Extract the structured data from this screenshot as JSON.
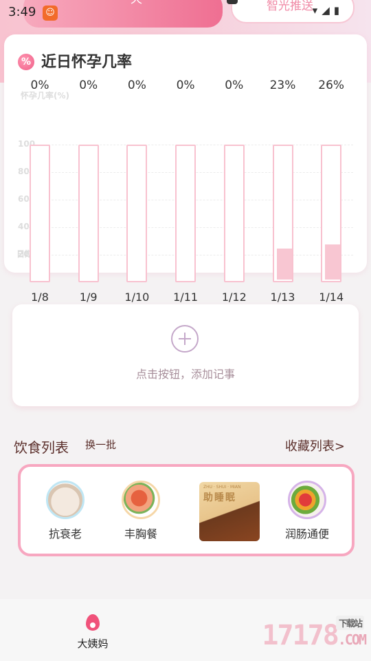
{
  "status": {
    "time": "3:49",
    "app_icon": "cat-face-icon",
    "system_icons": "▾◢▮"
  },
  "header": {
    "left_tab": "天",
    "right_tab": "智光推送"
  },
  "rate_card": {
    "title": "近日怀孕几率",
    "badge": "%",
    "chart_data": {
      "type": "bar",
      "title": "近日怀孕几率",
      "ylabel": "怀孕几率(%)",
      "xlabel": "日期",
      "ylim": [
        0,
        100
      ],
      "yticks": [
        "20",
        "40",
        "60",
        "80",
        "100"
      ],
      "categories": [
        "1/8",
        "1/9",
        "1/10",
        "1/11",
        "1/12",
        "1/13",
        "1/14"
      ],
      "values": [
        0,
        0,
        0,
        0,
        0,
        23,
        26
      ],
      "labels": [
        "0%",
        "0%",
        "0%",
        "0%",
        "0%",
        "23%",
        "26%"
      ]
    }
  },
  "note": {
    "hint": "点击按钮，添加记事"
  },
  "diet": {
    "title": "饮食列表",
    "swap": "换一批",
    "favorites": "收藏列表>",
    "items": [
      {
        "name": "抗衰老"
      },
      {
        "name": "丰胸餐"
      },
      {
        "name": "助睡眠",
        "sub": "ZHU · SHUI · MIAN"
      },
      {
        "name": "润肠通便"
      }
    ]
  },
  "nav": {
    "items": [
      {
        "label": "大姨妈"
      }
    ]
  },
  "watermark": {
    "text": "17178",
    "suffix": ".COM",
    "tag": "下载站"
  }
}
